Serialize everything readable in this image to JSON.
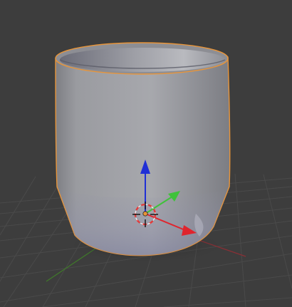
{
  "viewport": {
    "background_color": "#3d3d3d",
    "grid_color": "#4a4a4a",
    "x_axis_line_color": "#8a2f35",
    "y_axis_line_color": "#3f7a2a"
  },
  "object": {
    "type": "cup-mesh",
    "selected": true,
    "selection_outline_color": "#e8953a",
    "shading": "solid"
  },
  "gizmo": {
    "axes": [
      {
        "axis": "x",
        "color": "#e0242d",
        "icon": "red-arrow"
      },
      {
        "axis": "y",
        "color": "#3fc23a",
        "icon": "green-arrow"
      },
      {
        "axis": "z",
        "color": "#1f2fd6",
        "icon": "blue-arrow"
      }
    ],
    "origin_color": "#e8953a",
    "cursor_icon": "3d-cursor-icon"
  }
}
